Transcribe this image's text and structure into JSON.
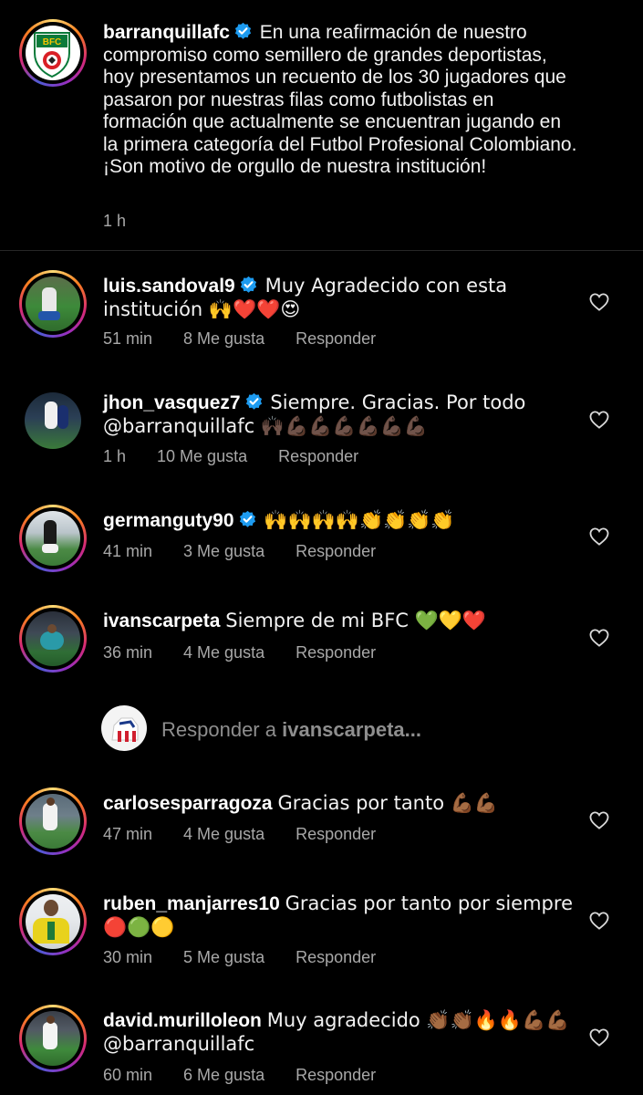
{
  "post": {
    "username": "barranquillafc",
    "caption": "En una reafirmación de nuestro compromiso como semillero de grandes deportistas, hoy presentamos un recuento de los 30 jugadores que pasaron por nuestras filas como futbolistas en formación que actualmente se encuentran jugando en la primera categoría del Futbol Profesional Colombiano. ¡Son motivo de orgullo de nuestra institución!",
    "time": "1 h",
    "logo_text": "BFC"
  },
  "comments": [
    {
      "username": "luis.sandoval9",
      "verified": true,
      "text": "Muy Agradecido con esta institución 🙌❤️❤️😍",
      "time": "51 min",
      "likes": "8 Me gusta",
      "reply": "Responder"
    },
    {
      "username": "jhon_vasquez7",
      "verified": true,
      "text": "Siempre. Gracias. Por todo @barranquillafc 🙌🏿💪🏿💪🏿💪🏿💪🏿💪🏿💪🏿",
      "time": "1 h",
      "likes": "10 Me gusta",
      "reply": "Responder"
    },
    {
      "username": "germanguty90",
      "verified": true,
      "text": "🙌🙌🙌🙌👏👏👏👏",
      "time": "41 min",
      "likes": "3 Me gusta",
      "reply": "Responder"
    },
    {
      "username": "ivanscarpeta",
      "verified": false,
      "text": "Siempre de mi BFC 💚💛❤️",
      "time": "36 min",
      "likes": "4 Me gusta",
      "reply": "Responder"
    },
    {
      "username": "carlosesparragoza",
      "verified": false,
      "text": "Gracias por tanto 💪🏾💪🏾",
      "time": "47 min",
      "likes": "4 Me gusta",
      "reply": "Responder"
    },
    {
      "username": "ruben_manjarres10",
      "verified": false,
      "text": "Gracias por tanto por siempre 🔴🟢🟡",
      "time": "30 min",
      "likes": "5 Me gusta",
      "reply": "Responder"
    },
    {
      "username": "david.murilloleon",
      "verified": false,
      "text": "Muy agradecido 👏🏾👏🏾🔥🔥💪🏾💪🏾 @barranquillafc",
      "time": "60 min",
      "likes": "6 Me gusta",
      "reply": "Responder"
    }
  ],
  "reply_box": {
    "prefix": "Responder a",
    "target": "ivanscarpeta..."
  },
  "colors": {
    "background": "#000000",
    "muted_text": "#a8a8a8",
    "verified_blue": "#1d9bf0",
    "divider": "#262626"
  },
  "icons": [
    "verified-badge-icon",
    "heart-outline-icon"
  ]
}
